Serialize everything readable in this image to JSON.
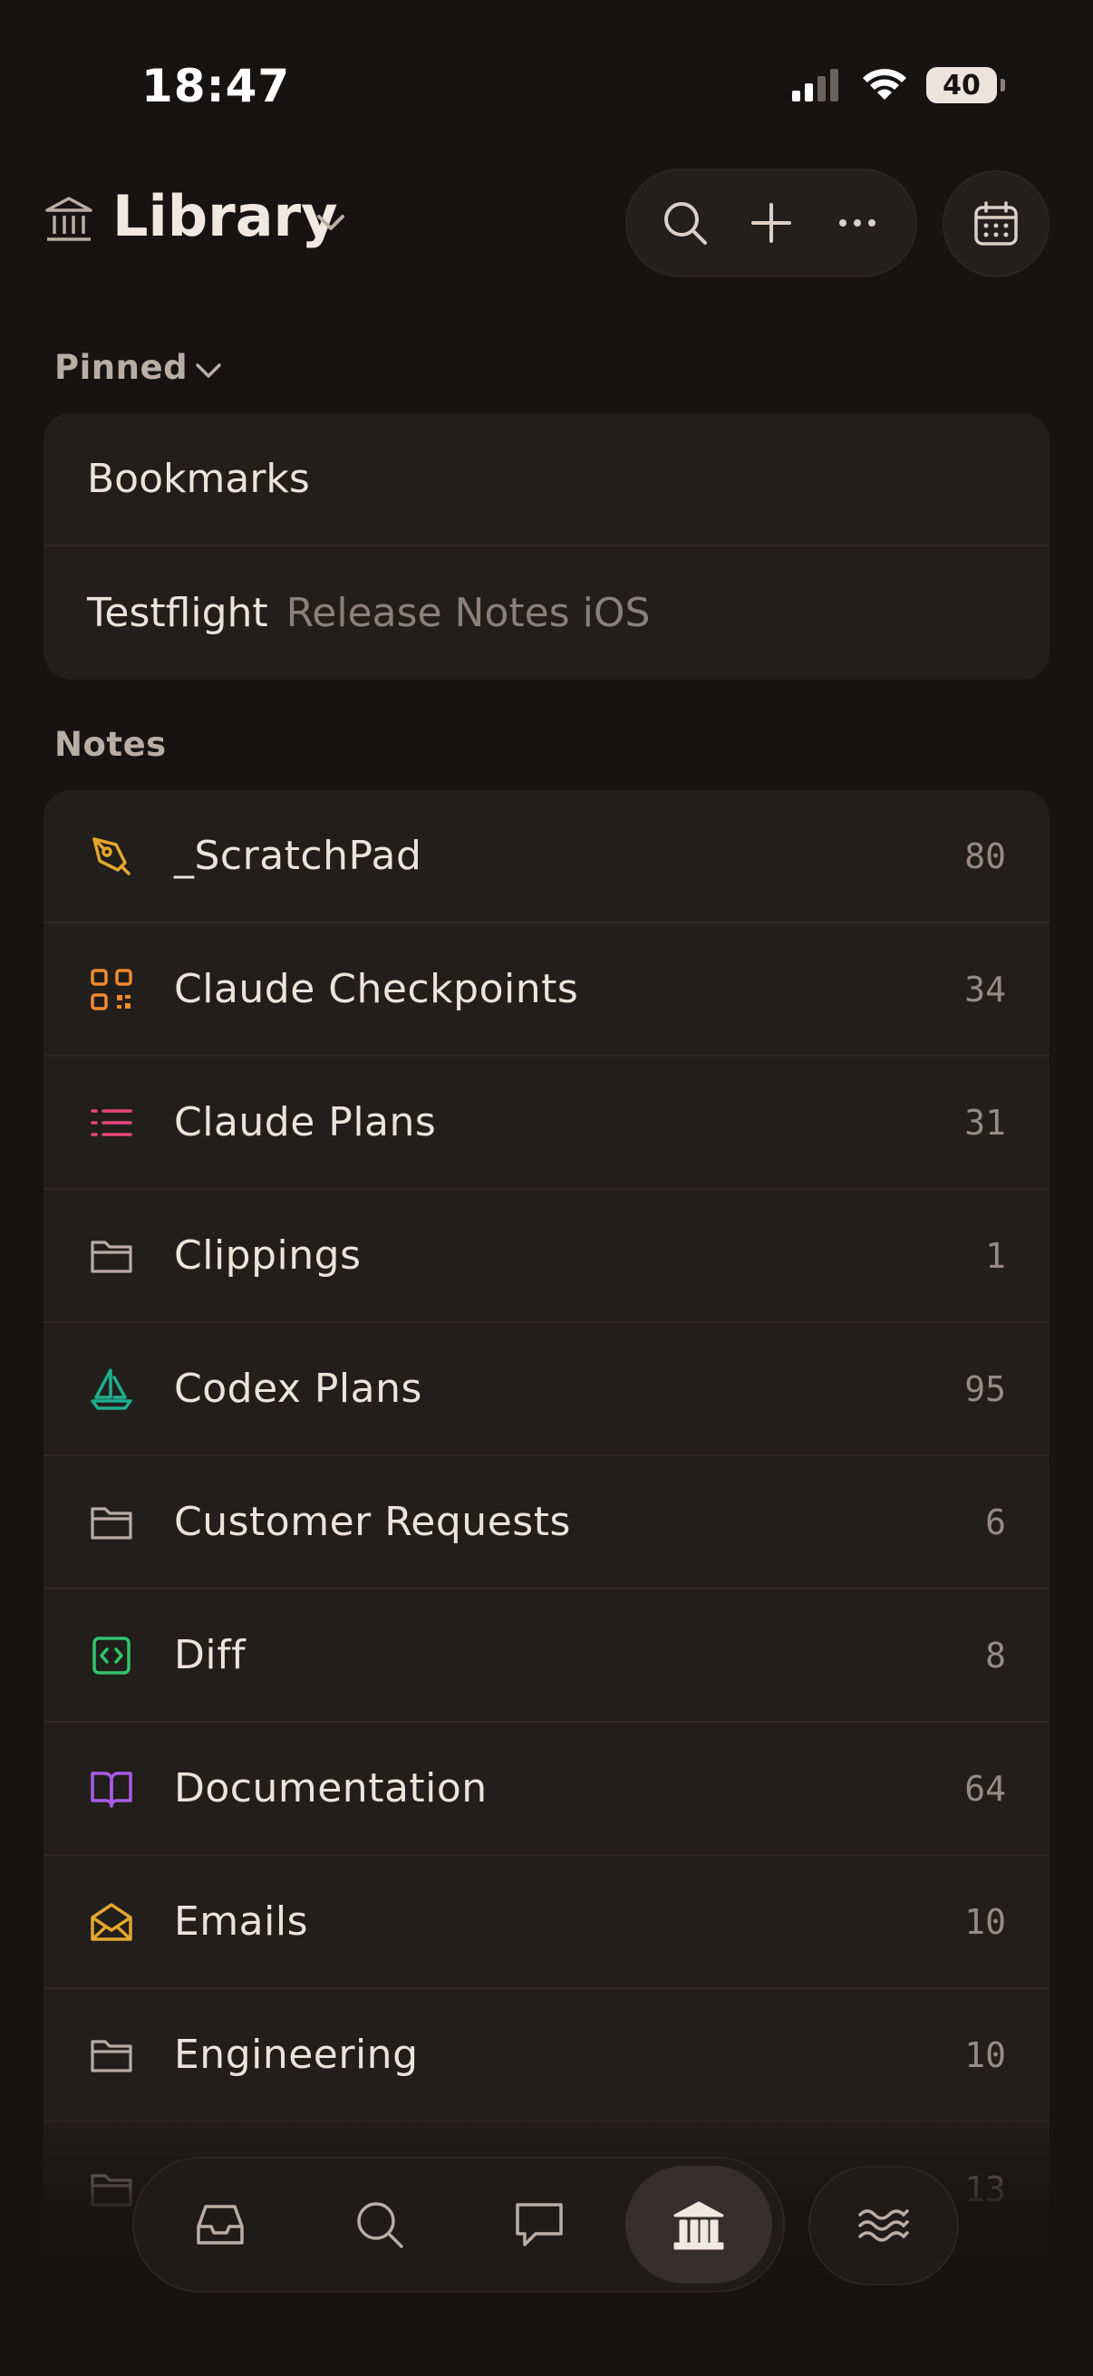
{
  "status_bar": {
    "time": "18:47",
    "battery": "40"
  },
  "header": {
    "title": "Library"
  },
  "pinned": {
    "section_label": "Pinned",
    "items": [
      {
        "label": "Bookmarks",
        "sub": ""
      },
      {
        "label": "Testflight",
        "sub": "Release Notes iOS"
      }
    ]
  },
  "notes": {
    "section_label": "Notes",
    "items": [
      {
        "label": "_ScratchPad",
        "count": "80",
        "icon": "pen-nib-icon",
        "color": "#E3A72F"
      },
      {
        "label": "Claude Checkpoints",
        "count": "34",
        "icon": "qr-code-icon",
        "color": "#F08A2E"
      },
      {
        "label": "Claude Plans",
        "count": "31",
        "icon": "list-icon",
        "color": "#E8457D"
      },
      {
        "label": "Clippings",
        "count": "1",
        "icon": "folder-icon",
        "color": "#B7ADA5"
      },
      {
        "label": "Codex Plans",
        "count": "95",
        "icon": "sailboat-icon",
        "color": "#1FAE8C"
      },
      {
        "label": "Customer Requests",
        "count": "6",
        "icon": "folder-icon",
        "color": "#B7ADA5"
      },
      {
        "label": "Diff",
        "count": "8",
        "icon": "code-icon",
        "color": "#32C46A"
      },
      {
        "label": "Documentation",
        "count": "64",
        "icon": "book-icon",
        "color": "#A85BE8"
      },
      {
        "label": "Emails",
        "count": "10",
        "icon": "envelope-icon",
        "color": "#E3A72F"
      },
      {
        "label": "Engineering",
        "count": "10",
        "icon": "folder-icon",
        "color": "#B7ADA5"
      },
      {
        "label": "",
        "count": "13",
        "icon": "folder-icon",
        "color": "#B7ADA5"
      }
    ]
  },
  "tabbar": {
    "items": [
      {
        "name": "inbox",
        "icon": "inbox-icon"
      },
      {
        "name": "search",
        "icon": "search-icon"
      },
      {
        "name": "chat",
        "icon": "chat-icon"
      },
      {
        "name": "library",
        "icon": "library-icon",
        "active": true
      }
    ],
    "extra": {
      "icon": "waves-icon"
    }
  },
  "colors": {
    "background": "#161312",
    "card": "#221E1C",
    "text": "#ECE4DB",
    "muted": "#968C85"
  }
}
